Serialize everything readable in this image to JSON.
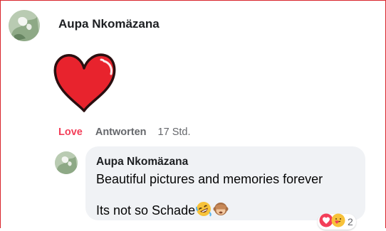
{
  "comment": {
    "author": "Aupa Nkomäzana",
    "sticker": "heart",
    "actions": {
      "love": "Love",
      "reply": "Antworten",
      "time": "17 Std."
    }
  },
  "reply": {
    "author": "Aupa Nkomäzana",
    "text_line1": "Beautiful pictures and memories forever",
    "text_line2": "Its not so Schade",
    "emojis": [
      "rolling-laughing-emoji",
      "see-no-evil-monkey-emoji"
    ],
    "reactions": {
      "icons": [
        "love-reaction-icon",
        "care-reaction-icon"
      ],
      "count": "2"
    }
  },
  "colors": {
    "love": "#f33e58",
    "muted": "#65676b",
    "bubble": "#f0f2f5",
    "heart": "#e8232d"
  }
}
